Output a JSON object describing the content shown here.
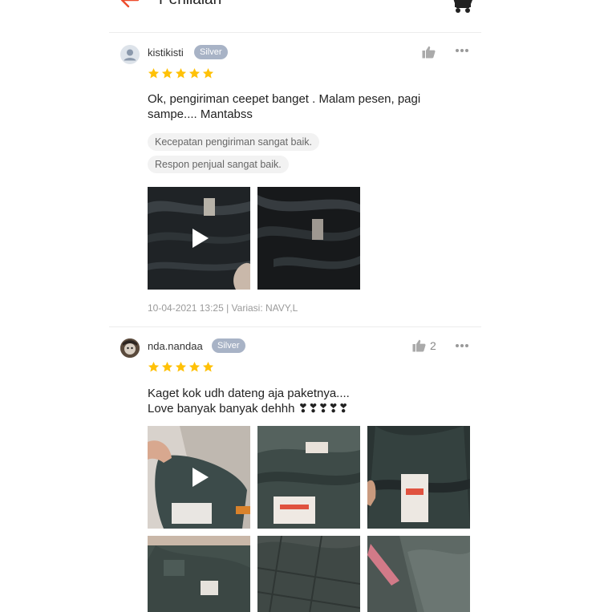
{
  "header": {
    "title": "Penilaian"
  },
  "reviews": [
    {
      "username": "kistikisti",
      "badge": "Silver",
      "like_count": "",
      "rating": 5,
      "comment": "Ok, pengiriman ceepet banget . Malam pesen, pagi\nsampe.... Mantabss",
      "tags": [
        "Kecepatan pengiriman sangat baik.",
        "Respon penjual sangat baik."
      ],
      "meta": "10-04-2021 13:25 | Variasi: NAVY,L"
    },
    {
      "username": "nda.nandaa",
      "badge": "Silver",
      "like_count": "2",
      "rating": 5,
      "comment": "Kaget kok udh dateng aja paketnya....\nLove banyak banyak dehhh ❣❣❣❣❣"
    }
  ],
  "colors": {
    "accent": "#ee4d2d",
    "star": "#ffc107",
    "badge": "#a8b3c6"
  },
  "icons": {
    "back": "arrow-left-icon",
    "cart": "cart-icon",
    "like": "thumb-up-icon",
    "more": "more-dots-icon",
    "play": "play-icon",
    "star": "star-icon"
  }
}
